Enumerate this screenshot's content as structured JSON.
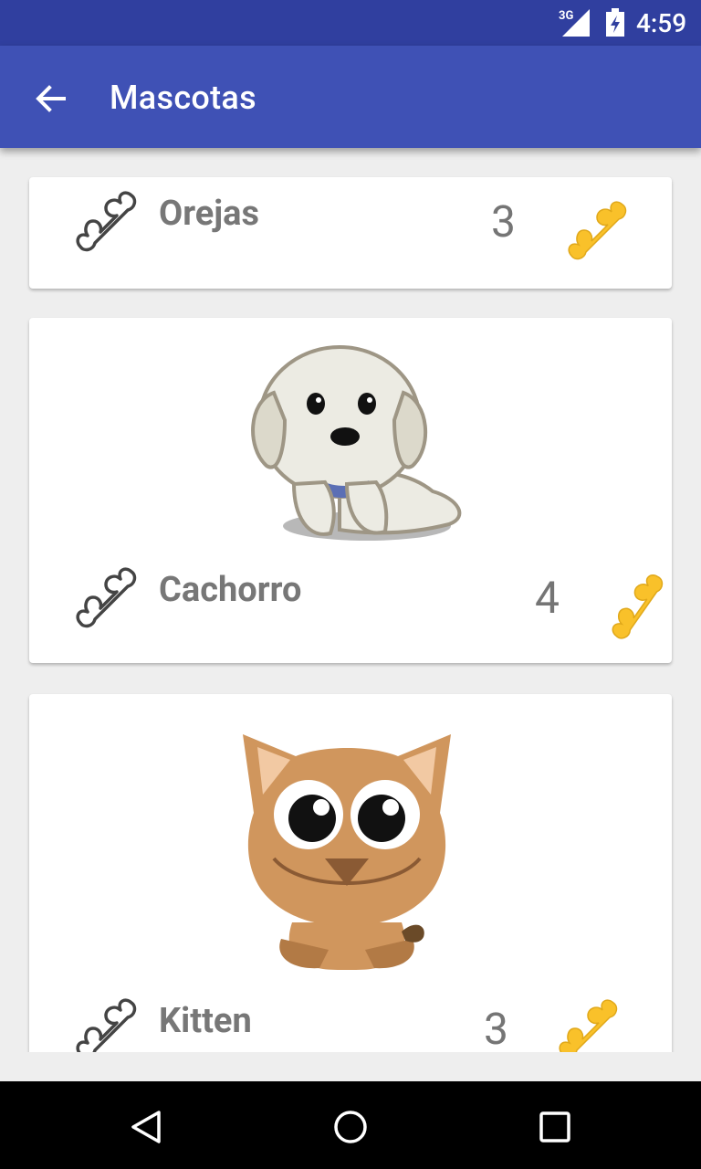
{
  "status_bar": {
    "network": "3G",
    "time": "4:59"
  },
  "app_bar": {
    "title": "Mascotas",
    "back_icon": "arrow-back-icon"
  },
  "pets": [
    {
      "name": "Orejas",
      "likes": "3",
      "image": "none"
    },
    {
      "name": "Cachorro",
      "likes": "4",
      "image": "puppy"
    },
    {
      "name": "Kitten",
      "likes": "3",
      "image": "kitten"
    }
  ],
  "icons": {
    "rate": "bone-outline-icon",
    "likes": "bone-gold-icon"
  },
  "colors": {
    "status_bar": "#303f9f",
    "app_bar": "#3f51b5",
    "bone_gold": "#f9c12a",
    "background": "#eeeeee"
  },
  "nav_bar": {
    "back": "nav-back-icon",
    "home": "nav-home-icon",
    "recents": "nav-recents-icon"
  }
}
